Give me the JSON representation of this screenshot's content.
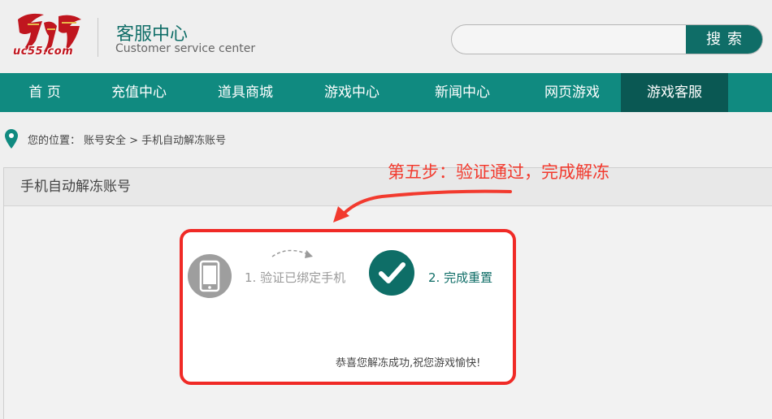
{
  "header": {
    "logo_text": "uc55.com",
    "title": "客服中心",
    "subtitle": "Customer service center",
    "search": {
      "placeholder": "",
      "button_label": "搜索"
    }
  },
  "nav": {
    "items": [
      {
        "label": "首 页",
        "active": false
      },
      {
        "label": "充值中心",
        "active": false
      },
      {
        "label": "道具商城",
        "active": false
      },
      {
        "label": "游戏中心",
        "active": false
      },
      {
        "label": "新闻中心",
        "active": false
      },
      {
        "label": "网页游戏",
        "active": false
      },
      {
        "label": "游戏客服",
        "active": true
      }
    ]
  },
  "breadcrumb": {
    "prefix": "您的位置：",
    "path": "账号安全 > 手机自动解冻账号"
  },
  "panel": {
    "title": "手机自动解冻账号"
  },
  "annotation": {
    "text": "第五步：验证通过，完成解冻",
    "color": "#f23a2e"
  },
  "steps": [
    {
      "label": "1. 验证已绑定手机",
      "icon": "phone-icon",
      "state": "done"
    },
    {
      "label": "2. 完成重置",
      "icon": "check-icon",
      "state": "current"
    }
  ],
  "message": "恭喜您解冻成功,祝您游戏愉快!",
  "colors": {
    "brand": "#0f6d67",
    "nav": "#108a80",
    "nav_active": "#0a5853",
    "highlight": "#f02a26"
  }
}
